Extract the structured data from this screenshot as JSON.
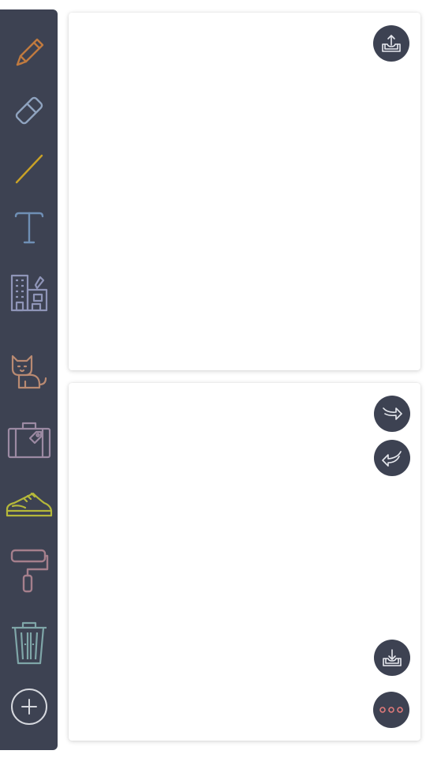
{
  "toolbar": {
    "tools": [
      {
        "name": "pencil",
        "icon": "pencil-icon",
        "color": "#c07a3f"
      },
      {
        "name": "eraser",
        "icon": "eraser-icon",
        "color": "#8fa3bf"
      },
      {
        "name": "line",
        "icon": "line-icon",
        "color": "#c9a227"
      },
      {
        "name": "text",
        "icon": "text-icon",
        "color": "#6f8fb5"
      },
      {
        "name": "buildings",
        "icon": "building-icon",
        "color": "#8f95b8"
      },
      {
        "name": "cat",
        "icon": "cat-icon",
        "color": "#b98a72"
      },
      {
        "name": "suitcase",
        "icon": "suitcase-icon",
        "color": "#9c8aa3"
      },
      {
        "name": "sneaker",
        "icon": "sneaker-icon",
        "color": "#b5b83a"
      },
      {
        "name": "paint-roller",
        "icon": "paint-roller-icon",
        "color": "#a57f8c"
      },
      {
        "name": "trash",
        "icon": "trash-icon",
        "color": "#7fa6a8"
      }
    ],
    "add_icon": "plus-circle-icon",
    "add_color": "#d6d8de"
  },
  "panels": {
    "top": {
      "actions": [
        {
          "name": "upload",
          "icon": "upload-icon"
        }
      ]
    },
    "bottom": {
      "actions": [
        {
          "name": "redo",
          "icon": "redo-icon"
        },
        {
          "name": "undo",
          "icon": "undo-icon"
        },
        {
          "name": "download",
          "icon": "download-icon"
        },
        {
          "name": "more",
          "icon": "more-icon",
          "color": "#e07a7a"
        }
      ]
    }
  },
  "colors": {
    "toolbar_bg": "#3d4252",
    "button_bg": "#3d4252",
    "button_icon": "#e6e8ee"
  }
}
